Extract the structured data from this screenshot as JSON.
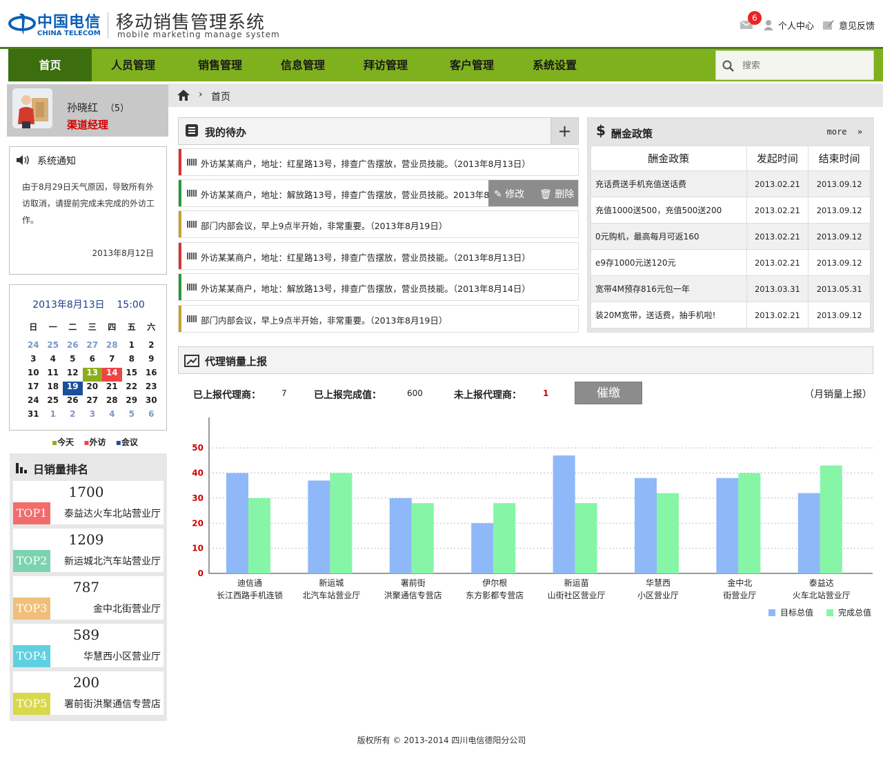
{
  "header": {
    "logo_cn": "中国电信",
    "logo_en": "CHINA TELECOM",
    "system_title": "移动销售管理系统",
    "system_subtitle": "mobile marketing manage system",
    "mail_count": "6",
    "personal_center": "个人中心",
    "feedback": "意见反馈"
  },
  "nav": {
    "items": [
      "首页",
      "人员管理",
      "销售管理",
      "信息管理",
      "拜访管理",
      "客户管理",
      "系统设置"
    ],
    "active": 0,
    "search_placeholder": "搜索"
  },
  "profile": {
    "name": "孙晓红",
    "count": "（5）",
    "role": "渠道经理"
  },
  "notice": {
    "title": "系统通知",
    "body": "由于8月29日天气原因，导致所有外访取消，请提前完成未完成的外访工作。",
    "date": "2013年8月12日"
  },
  "calendar": {
    "datetime": "2013年8月13日    15:00",
    "weekdays": [
      "日",
      "一",
      "二",
      "三",
      "四",
      "五",
      "六"
    ],
    "weeks": [
      [
        "24",
        "25",
        "26",
        "27",
        "28",
        "1",
        "2"
      ],
      [
        "3",
        "4",
        "5",
        "6",
        "7",
        "8",
        "9"
      ],
      [
        "10",
        "11",
        "12",
        "13",
        "14",
        "15",
        "16"
      ],
      [
        "17",
        "18",
        "19",
        "20",
        "21",
        "22",
        "23"
      ],
      [
        "24",
        "25",
        "26",
        "27",
        "28",
        "29",
        "30"
      ],
      [
        "31",
        "1",
        "2",
        "3",
        "4",
        "5",
        "6"
      ]
    ],
    "legend": {
      "today": "今天",
      "visit": "外访",
      "meeting": "会议"
    },
    "colors": {
      "today": "#8dad1b",
      "visit": "#e44444",
      "meeting": "#1b4f9c"
    }
  },
  "ranking": {
    "title": "日销量排名",
    "items": [
      {
        "tag": "TOP1",
        "value": "1700",
        "name": "泰益达火车北站营业厅",
        "color": "#f36c6c"
      },
      {
        "tag": "TOP2",
        "value": "1209",
        "name": "新运城北汽车站营业厅",
        "color": "#7dd3b0"
      },
      {
        "tag": "TOP3",
        "value": "787",
        "name": "金中北街营业厅",
        "color": "#f0c07a"
      },
      {
        "tag": "TOP4",
        "value": "589",
        "name": "华慧西小区营业厅",
        "color": "#5fd0e0"
      },
      {
        "tag": "TOP5",
        "value": "200",
        "name": "署前街洪聚通信专营店",
        "color": "#d8d84a"
      }
    ]
  },
  "breadcrumb": {
    "current": "首页"
  },
  "todo": {
    "title": "我的待办",
    "edit": "修改",
    "delete": "删除",
    "items": [
      {
        "text": "外访某某商户，地址：红星路13号，排查广告摆放，营业员技能。（2013年8月13日）",
        "color": "#e03030"
      },
      {
        "text": "外访某某商户，地址：解放路13号，排查广告摆放，营业员技能。2013年8月",
        "color": "#2a9a3a"
      },
      {
        "text": "部门内部会议，早上9点半开始，非常重要。（2013年8月19日）",
        "color": "#c9a22a"
      },
      {
        "text": "外访某某商户，地址：红星路13号，排查广告摆放，营业员技能。（2013年8月13日）",
        "color": "#e03030"
      },
      {
        "text": "外访某某商户，地址：解放路13号，排查广告摆放，营业员技能。（2013年8月14日）",
        "color": "#2a9a3a"
      },
      {
        "text": "部门内部会议，早上9点半开始，非常重要。（2013年8月19日）",
        "color": "#c9a22a"
      }
    ]
  },
  "policy": {
    "title": "酬金政策",
    "more": "more",
    "headers": [
      "酬金政策",
      "发起时间",
      "结束时间"
    ],
    "rows": [
      [
        "充话费送手机充值送话费",
        "2013.02.21",
        "2013.09.12"
      ],
      [
        "充值1000送500，充值500送200",
        "2013.02.21",
        "2013.09.12"
      ],
      [
        "0元购机，最高每月可返160",
        "2013.02.21",
        "2013.09.12"
      ],
      [
        "e9存1000元送120元",
        "2013.02.21",
        "2013.09.12"
      ],
      [
        "宽带4M预存816元包一年",
        "2013.03.31",
        "2013.05.31"
      ],
      [
        "装20M宽带，送话费，抽手机啦!",
        "2013.02.21",
        "2013.09.12"
      ]
    ]
  },
  "report": {
    "title": "代理销量上报",
    "reported_label": "已上报代理商：",
    "reported_value": "7",
    "completed_label": "已上报完成值：",
    "completed_value": "600",
    "unreported_label": "未上报代理商：",
    "unreported_value": "1",
    "urge_button": "催缴",
    "monthly_link": "（月销量上报）"
  },
  "chart_data": {
    "type": "bar",
    "categories": [
      [
        "迪信通",
        "长江西路手机连锁"
      ],
      [
        "新运城",
        "北汽车站营业厅"
      ],
      [
        "署前街",
        "洪聚通信专营店"
      ],
      [
        "伊尔根",
        "东方影都专营店"
      ],
      [
        "新运苗",
        "山街社区营业厅"
      ],
      [
        "华慧西",
        "小区营业厅"
      ],
      [
        "金中北",
        "街营业厅"
      ],
      [
        "泰益达",
        "火车北站营业厅"
      ]
    ],
    "series": [
      {
        "name": "目标总值",
        "color": "#8fb8f8",
        "values": [
          40,
          37,
          30,
          20,
          47,
          38,
          38,
          32
        ]
      },
      {
        "name": "完成总值",
        "color": "#86f6a6",
        "values": [
          30,
          40,
          28,
          28,
          28,
          32,
          40,
          43
        ]
      }
    ],
    "ylim": [
      0,
      55
    ],
    "yticks": [
      0,
      10,
      20,
      30,
      40,
      50
    ],
    "grid": true,
    "legend": "bottom-right"
  },
  "footer": "版权所有 © 2013-2014 四川电信德阳分公司"
}
